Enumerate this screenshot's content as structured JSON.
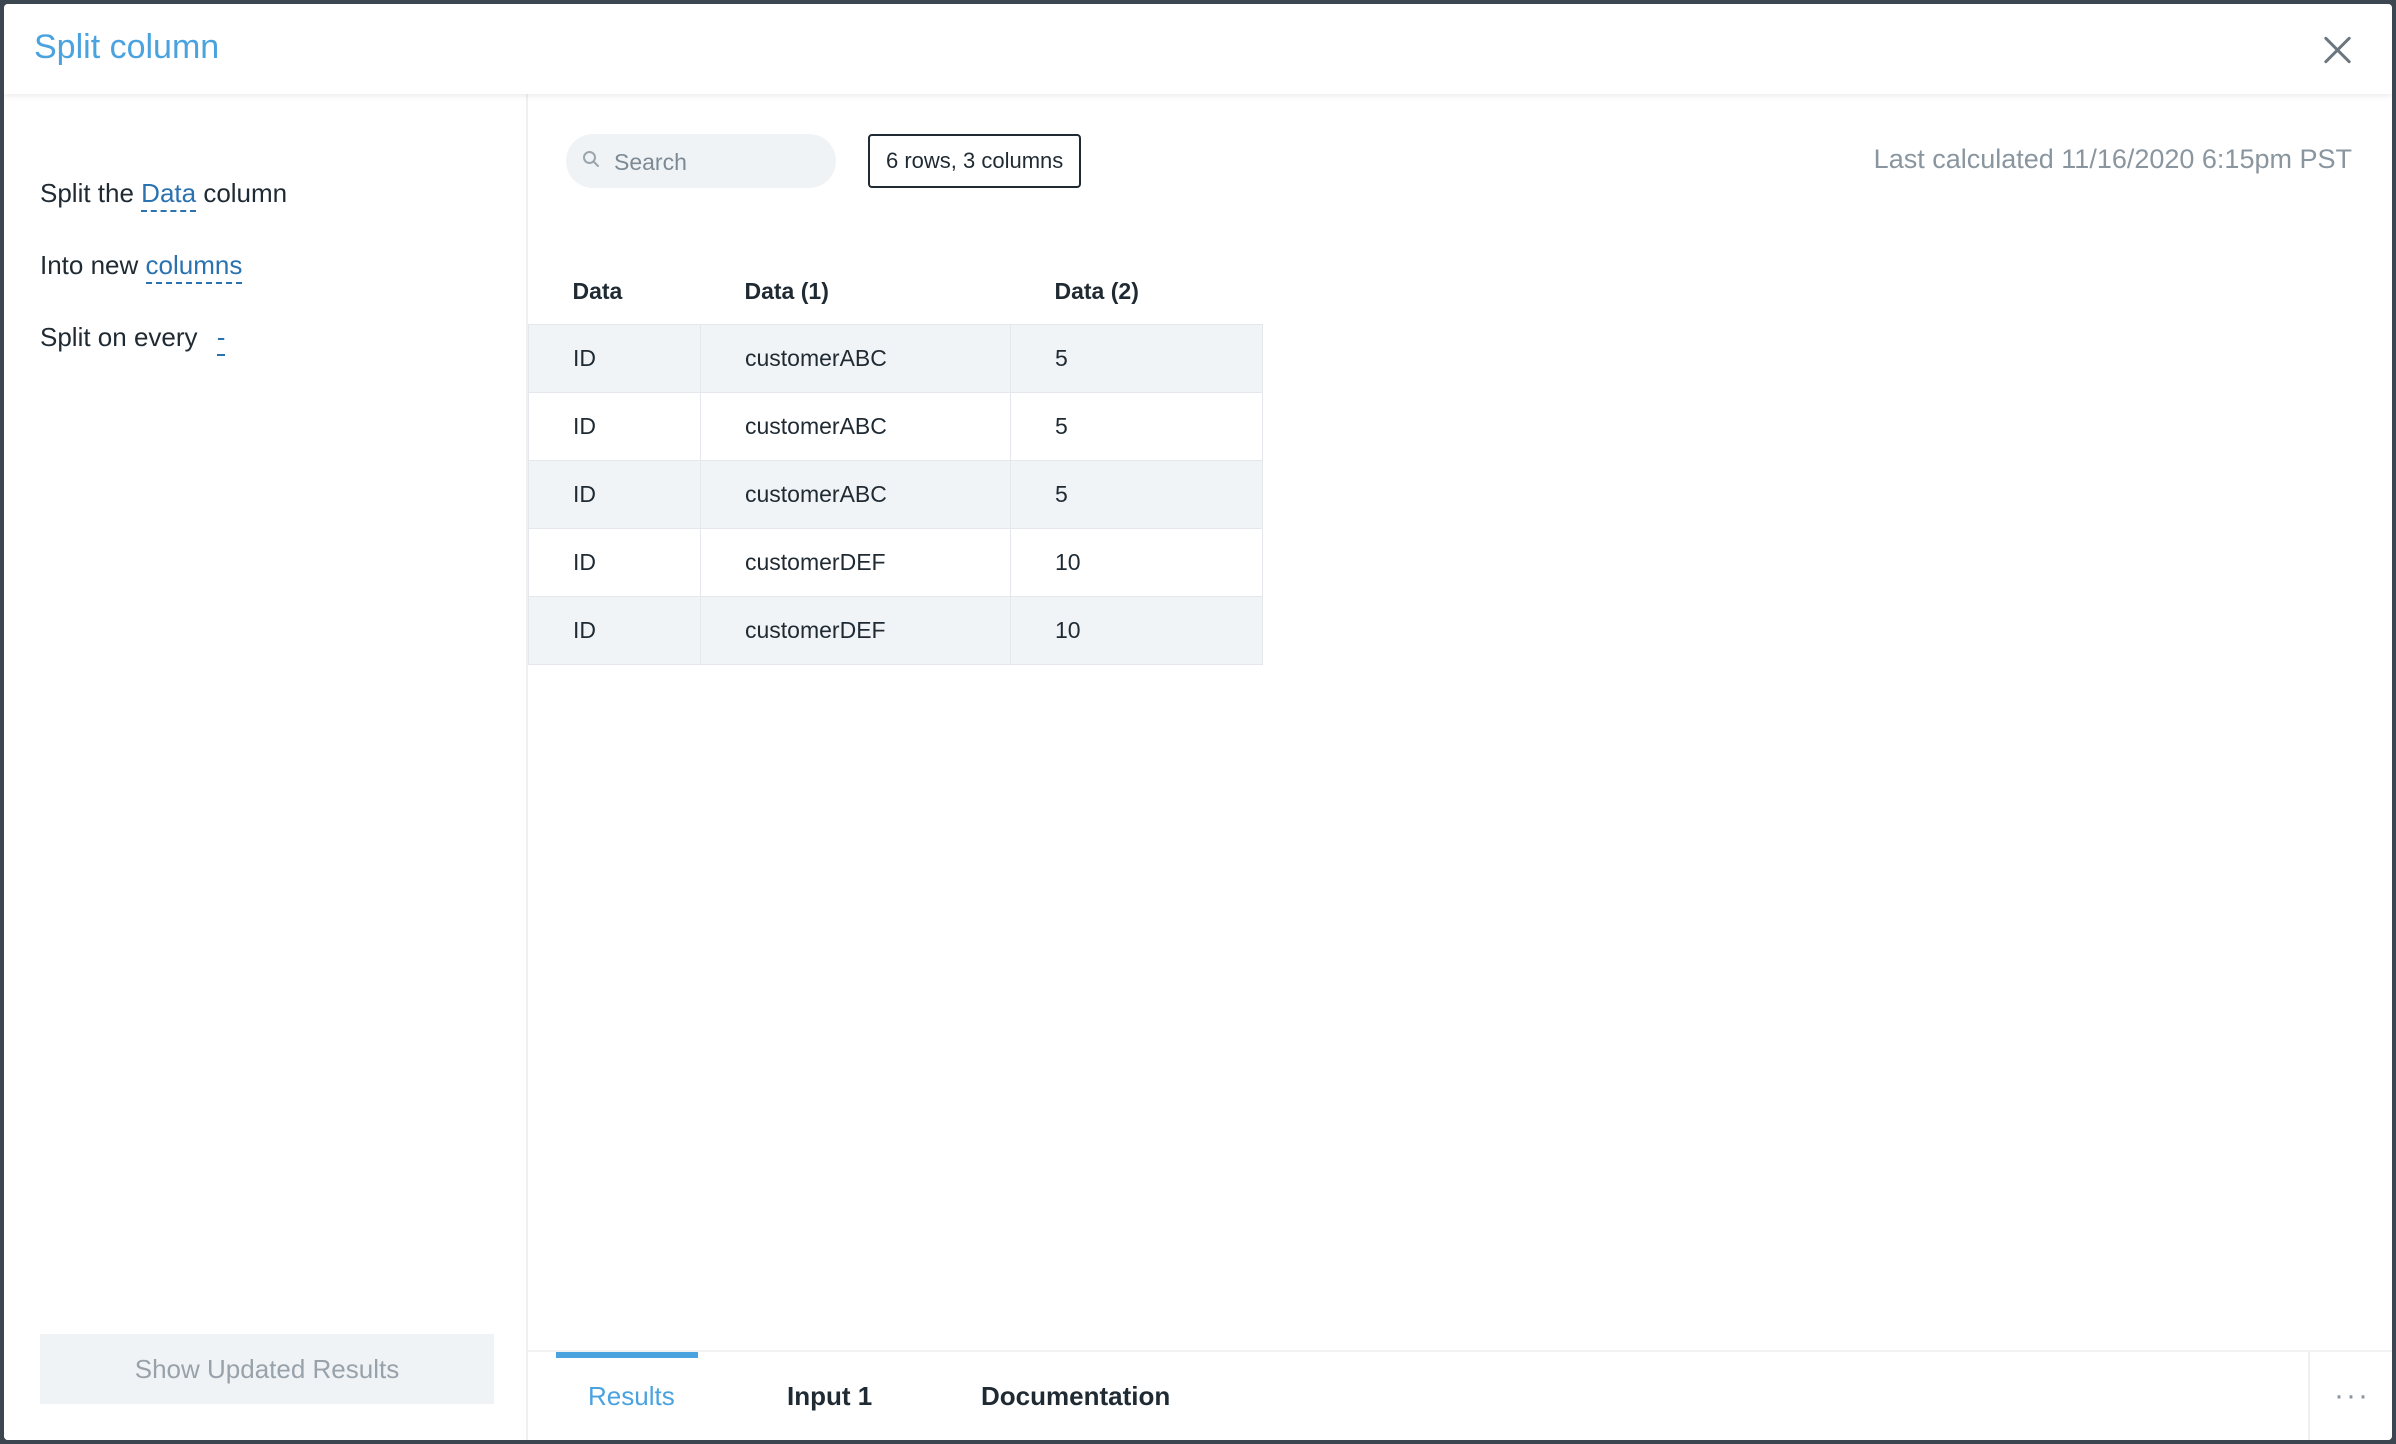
{
  "modal": {
    "title": "Split column"
  },
  "sidebar": {
    "params": [
      {
        "prefix": "Split the ",
        "link": "Data",
        "suffix": " column"
      },
      {
        "prefix": "Into new ",
        "link": "columns",
        "suffix": ""
      },
      {
        "prefix": "Split on every ",
        "link": "-",
        "suffix": ""
      }
    ],
    "show_button_label": "Show Updated Results"
  },
  "toolbar": {
    "search_placeholder": "Search",
    "row_count_badge": "6 rows, 3 columns",
    "last_calculated": "Last calculated 11/16/2020 6:15pm PST"
  },
  "table": {
    "columns": [
      "Data",
      "Data (1)",
      "Data (2)"
    ],
    "rows": [
      [
        "ID",
        "customerABC",
        "5"
      ],
      [
        "ID",
        "customerABC",
        "5"
      ],
      [
        "ID",
        "customerABC",
        "5"
      ],
      [
        "ID",
        "customerDEF",
        "10"
      ],
      [
        "ID",
        "customerDEF",
        "10"
      ]
    ]
  },
  "footer": {
    "tabs": [
      {
        "label": "Results",
        "active": true
      },
      {
        "label": "Input 1",
        "active": false
      },
      {
        "label": "Documentation",
        "active": false
      }
    ],
    "more_icon": "···"
  },
  "colors": {
    "accent": "#4aa3df",
    "link": "#2b72b0",
    "text": "#1f2a33",
    "muted": "#8a969f"
  }
}
